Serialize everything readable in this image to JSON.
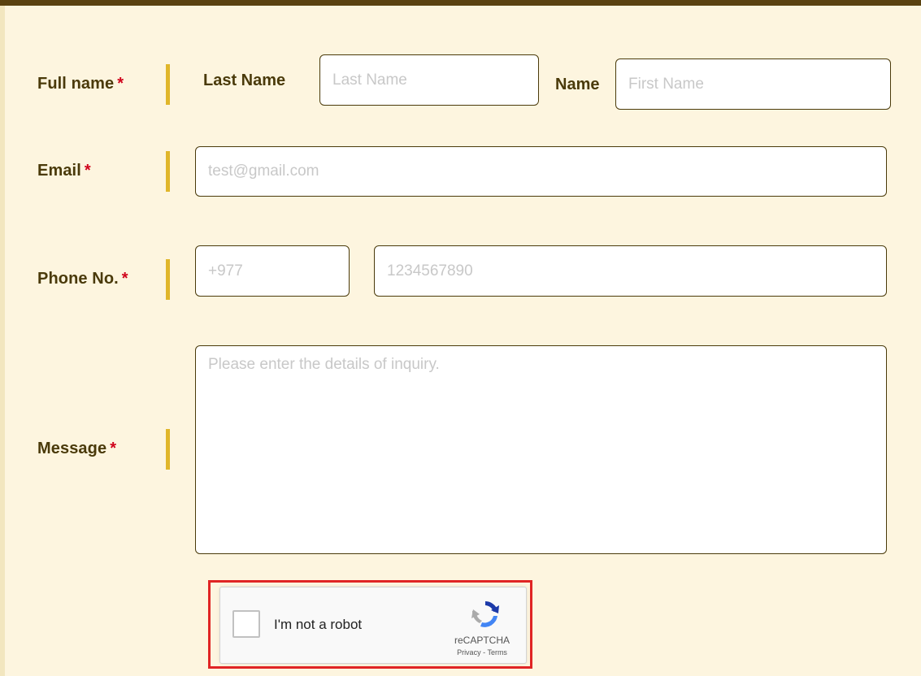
{
  "form": {
    "full_name": {
      "label": "Full name",
      "required_mark": "*",
      "last_name_label": "Last Name",
      "last_name_placeholder": "Last Name",
      "last_name_value": "",
      "first_name_label": "Name",
      "first_name_placeholder": "First Name",
      "first_name_value": ""
    },
    "email": {
      "label": "Email",
      "required_mark": "*",
      "placeholder": "test@gmail.com",
      "value": ""
    },
    "phone": {
      "label": "Phone No.",
      "required_mark": "*",
      "code_placeholder": "+977",
      "code_value": "",
      "number_placeholder": "1234567890",
      "number_value": ""
    },
    "message": {
      "label": "Message",
      "required_mark": "*",
      "placeholder": "Please enter the details of inquiry.",
      "value": ""
    }
  },
  "captcha": {
    "label": "I'm not a robot",
    "brand": "reCAPTCHA",
    "privacy": "Privacy",
    "separator": "-",
    "terms": "Terms",
    "icon": "recaptcha-logo-icon",
    "checked": false
  },
  "colors": {
    "background": "#fdf5df",
    "top_bar": "#5a4210",
    "label_text": "#4a3a0a",
    "required": "#d0021b",
    "divider": "#e0b62a",
    "highlight_outline": "#e02424"
  }
}
